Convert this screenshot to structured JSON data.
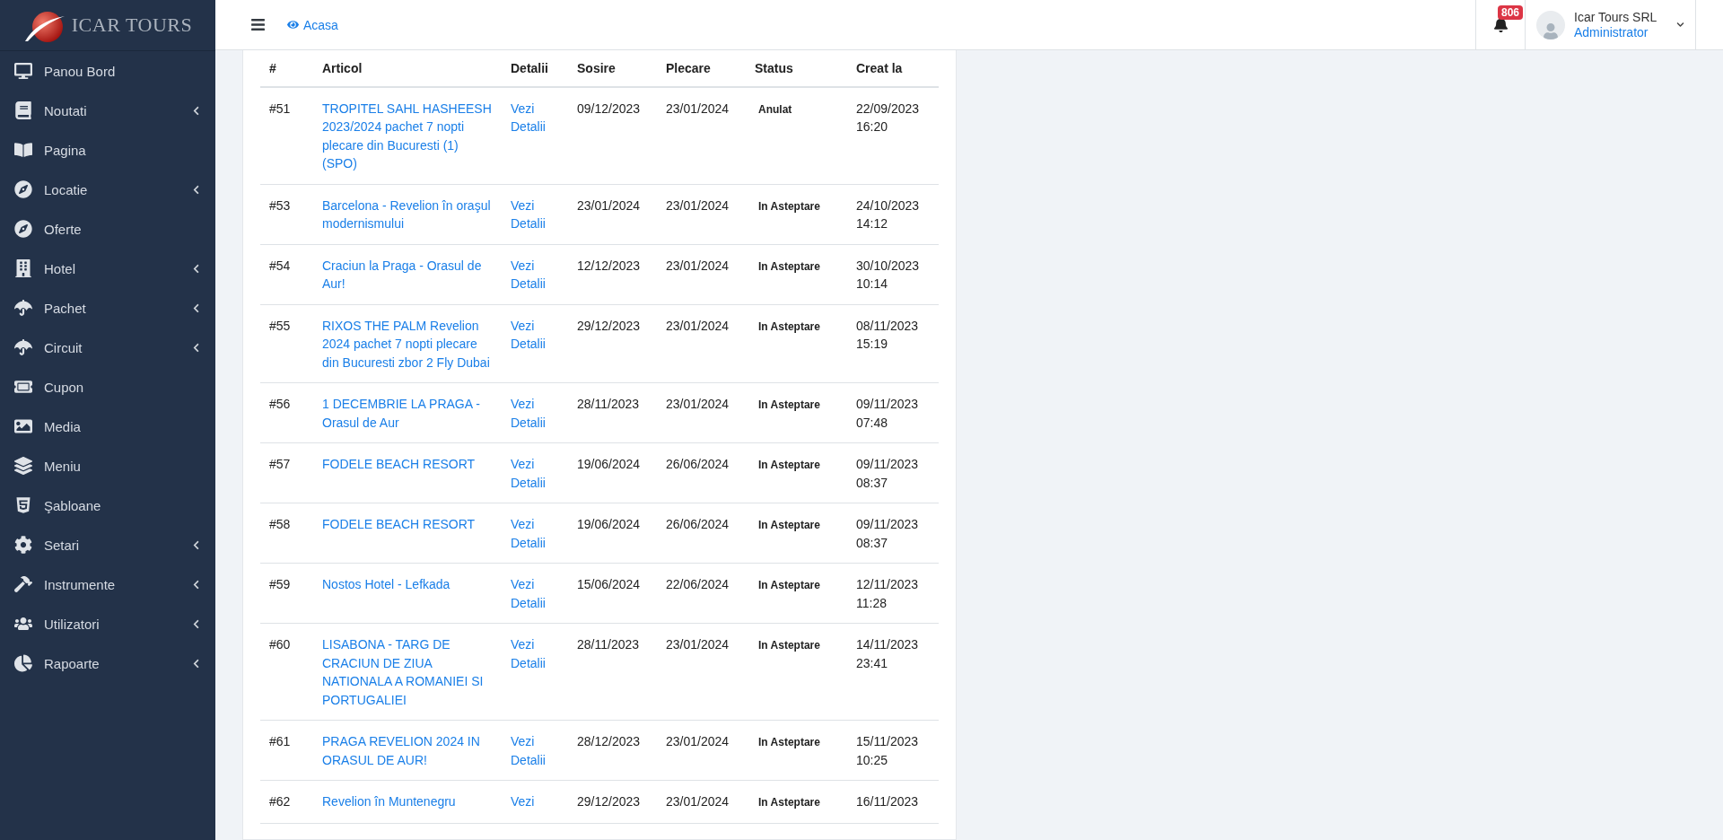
{
  "logo": {
    "text": "ICAR TOURS"
  },
  "sidebar": {
    "items": [
      {
        "label": "Panou Bord",
        "expandable": false
      },
      {
        "label": "Noutati",
        "expandable": true
      },
      {
        "label": "Pagina",
        "expandable": false
      },
      {
        "label": "Locatie",
        "expandable": true
      },
      {
        "label": "Oferte",
        "expandable": false
      },
      {
        "label": "Hotel",
        "expandable": true
      },
      {
        "label": "Pachet",
        "expandable": true
      },
      {
        "label": "Circuit",
        "expandable": true
      },
      {
        "label": "Cupon",
        "expandable": false
      },
      {
        "label": "Media",
        "expandable": false
      },
      {
        "label": "Meniu",
        "expandable": false
      },
      {
        "label": "Şabloane",
        "expandable": false
      },
      {
        "label": "Setari",
        "expandable": true
      },
      {
        "label": "Instrumente",
        "expandable": true
      },
      {
        "label": "Utilizatori",
        "expandable": true
      },
      {
        "label": "Rapoarte",
        "expandable": true
      }
    ]
  },
  "header": {
    "breadcrumb": "Acasa",
    "notifications": "806",
    "user": {
      "name": "Icar Tours SRL",
      "role": "Administrator"
    }
  },
  "table": {
    "columns": [
      "#",
      "Articol",
      "Detalii",
      "Sosire",
      "Plecare",
      "Status",
      "Creat la"
    ],
    "rows": [
      {
        "id": "#51",
        "article": "TROPITEL SAHL HASHEESH 2023/2024 pachet 7 nopti plecare din Bucuresti (1) (SPO)",
        "details": "Vezi Detalii",
        "arrival": "09/12/2023",
        "departure": "23/01/2024",
        "status": "Anulat",
        "created": "22/09/2023 16:20"
      },
      {
        "id": "#53",
        "article": "Barcelona - Revelion în oraşul modernismului",
        "details": "Vezi Detalii",
        "arrival": "23/01/2024",
        "departure": "23/01/2024",
        "status": "In Asteptare",
        "created": "24/10/2023 14:12"
      },
      {
        "id": "#54",
        "article": "Craciun la Praga - Orasul de Aur!",
        "details": "Vezi Detalii",
        "arrival": "12/12/2023",
        "departure": "23/01/2024",
        "status": "In Asteptare",
        "created": "30/10/2023 10:14"
      },
      {
        "id": "#55",
        "article": "RIXOS THE PALM Revelion 2024 pachet 7 nopti plecare din Bucuresti zbor 2 Fly Dubai",
        "details": "Vezi Detalii",
        "arrival": "29/12/2023",
        "departure": "23/01/2024",
        "status": "In Asteptare",
        "created": "08/11/2023 15:19"
      },
      {
        "id": "#56",
        "article": "1 DECEMBRIE LA PRAGA - Orasul de Aur",
        "details": "Vezi Detalii",
        "arrival": "28/11/2023",
        "departure": "23/01/2024",
        "status": "In Asteptare",
        "created": "09/11/2023 07:48"
      },
      {
        "id": "#57",
        "article": "FODELE BEACH RESORT",
        "details": "Vezi Detalii",
        "arrival": "19/06/2024",
        "departure": "26/06/2024",
        "status": "In Asteptare",
        "created": "09/11/2023 08:37"
      },
      {
        "id": "#58",
        "article": "FODELE BEACH RESORT",
        "details": "Vezi Detalii",
        "arrival": "19/06/2024",
        "departure": "26/06/2024",
        "status": "In Asteptare",
        "created": "09/11/2023 08:37"
      },
      {
        "id": "#59",
        "article": "Nostos Hotel - Lefkada",
        "details": "Vezi Detalii",
        "arrival": "15/06/2024",
        "departure": "22/06/2024",
        "status": "In Asteptare",
        "created": "12/11/2023 11:28"
      },
      {
        "id": "#60",
        "article": "LISABONA - TARG DE CRACIUN DE ZIUA NATIONALA A ROMANIEI SI PORTUGALIEI",
        "details": "Vezi Detalii",
        "arrival": "28/11/2023",
        "departure": "23/01/2024",
        "status": "In Asteptare",
        "created": "14/11/2023 23:41"
      },
      {
        "id": "#61",
        "article": "PRAGA REVELION 2024 IN ORASUL DE AUR!",
        "details": "Vezi Detalii",
        "arrival": "28/12/2023",
        "departure": "23/01/2024",
        "status": "In Asteptare",
        "created": "15/11/2023 10:25"
      },
      {
        "id": "#62",
        "article": "Revelion în Muntenegru",
        "details": "Vezi",
        "arrival": "29/12/2023",
        "departure": "23/01/2024",
        "status": "In Asteptare",
        "created": "16/11/2023"
      }
    ]
  }
}
